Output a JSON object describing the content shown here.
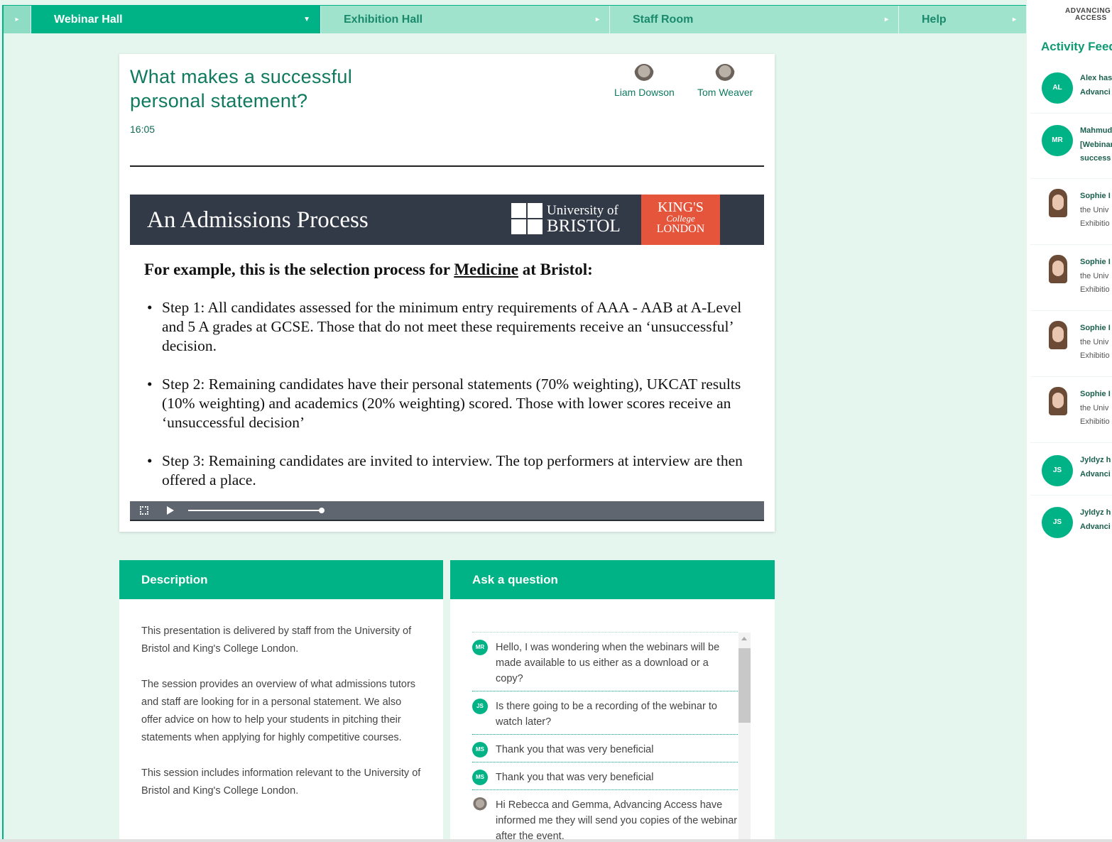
{
  "nav": {
    "tabs": [
      {
        "label": "Webinar Hall",
        "active": true
      },
      {
        "label": "Exhibition Hall",
        "active": false
      },
      {
        "label": "Staff Room",
        "active": false
      },
      {
        "label": "Help",
        "active": false
      }
    ]
  },
  "webinar": {
    "title": "What makes a successful personal statement?",
    "time": "16:05",
    "speakers": [
      {
        "name": "Liam Dowson"
      },
      {
        "name": "Tom Weaver"
      }
    ]
  },
  "slide": {
    "heading": "An Admissions Process",
    "bristol_logo": {
      "line1": "University of",
      "line2": "BRISTOL"
    },
    "kings_logo": {
      "line1": "KING'S",
      "line2": "College",
      "line3": "LONDON"
    },
    "example_prefix": "For example, this is the selection process for ",
    "example_subject": "Medicine",
    "example_suffix": " at Bristol:",
    "steps": [
      "Step 1: All candidates assessed for the minimum entry requirements of AAA - AAB at A-Level and 5 A grades at GCSE. Those that do not meet these requirements receive an ‘unsuccessful’ decision.",
      "Step 2: Remaining candidates have their personal statements (70% weighting), UKCAT results (10% weighting) and academics (20% weighting) scored. Those with lower scores receive an ‘unsuccessful decision’",
      "Step 3: Remaining candidates are invited to interview. The top performers at interview are then offered a place."
    ],
    "progress": 0.23
  },
  "description": {
    "heading": "Description",
    "paragraphs": [
      "This presentation is delivered by staff from the University of Bristol and King's College London.",
      "The session provides an overview of what admissions tutors and staff are looking for in a personal statement. We also offer advice on how to help your students in pitching their statements when applying for highly competitive courses.",
      "This session includes information relevant to the University of Bristol and King's College London."
    ]
  },
  "ask": {
    "heading": "Ask a question",
    "questions": [
      {
        "initials": "MR",
        "text": "Hello, I was wondering when the webinars will be made available to us either as a download or a copy?"
      },
      {
        "initials": "JS",
        "text": "Is there going to be a recording of the webinar to watch later?"
      },
      {
        "initials": "MS",
        "text": "Thank you that was very beneficial"
      },
      {
        "initials": "MS",
        "text": "Thank you that was very beneficial"
      },
      {
        "initials": "",
        "text": "Hi Rebecca and Gemma, Advancing Access have informed me they will send you copies of the webinar after the event."
      }
    ]
  },
  "activity": {
    "logo_top": "ADVANCING",
    "logo_bottom": "ACCESS",
    "title": "Activity Feed",
    "items": [
      {
        "initials": "AL",
        "lines": [
          "Alex has",
          "Advanci"
        ]
      },
      {
        "initials": "MR",
        "lines": [
          "Mahmud",
          "[Webinar",
          "success"
        ]
      },
      {
        "initials": "",
        "lines": [
          "Sophie I",
          "the Univ",
          "Exhibitio"
        ]
      },
      {
        "initials": "",
        "lines": [
          "Sophie I",
          "the Univ",
          "Exhibitio"
        ]
      },
      {
        "initials": "",
        "lines": [
          "Sophie I",
          "the Univ",
          "Exhibitio"
        ]
      },
      {
        "initials": "",
        "lines": [
          "Sophie I",
          "the Univ",
          "Exhibitio"
        ]
      },
      {
        "initials": "JS",
        "lines": [
          "Jyldyz h",
          "Advanci"
        ]
      },
      {
        "initials": "JS",
        "lines": [
          "Jyldyz h",
          "Advanci"
        ]
      }
    ]
  },
  "colors": {
    "accent": "#00b386",
    "title_green": "#0f7a5e",
    "slide_header": "#333a47",
    "kings_red": "#e4553b"
  }
}
